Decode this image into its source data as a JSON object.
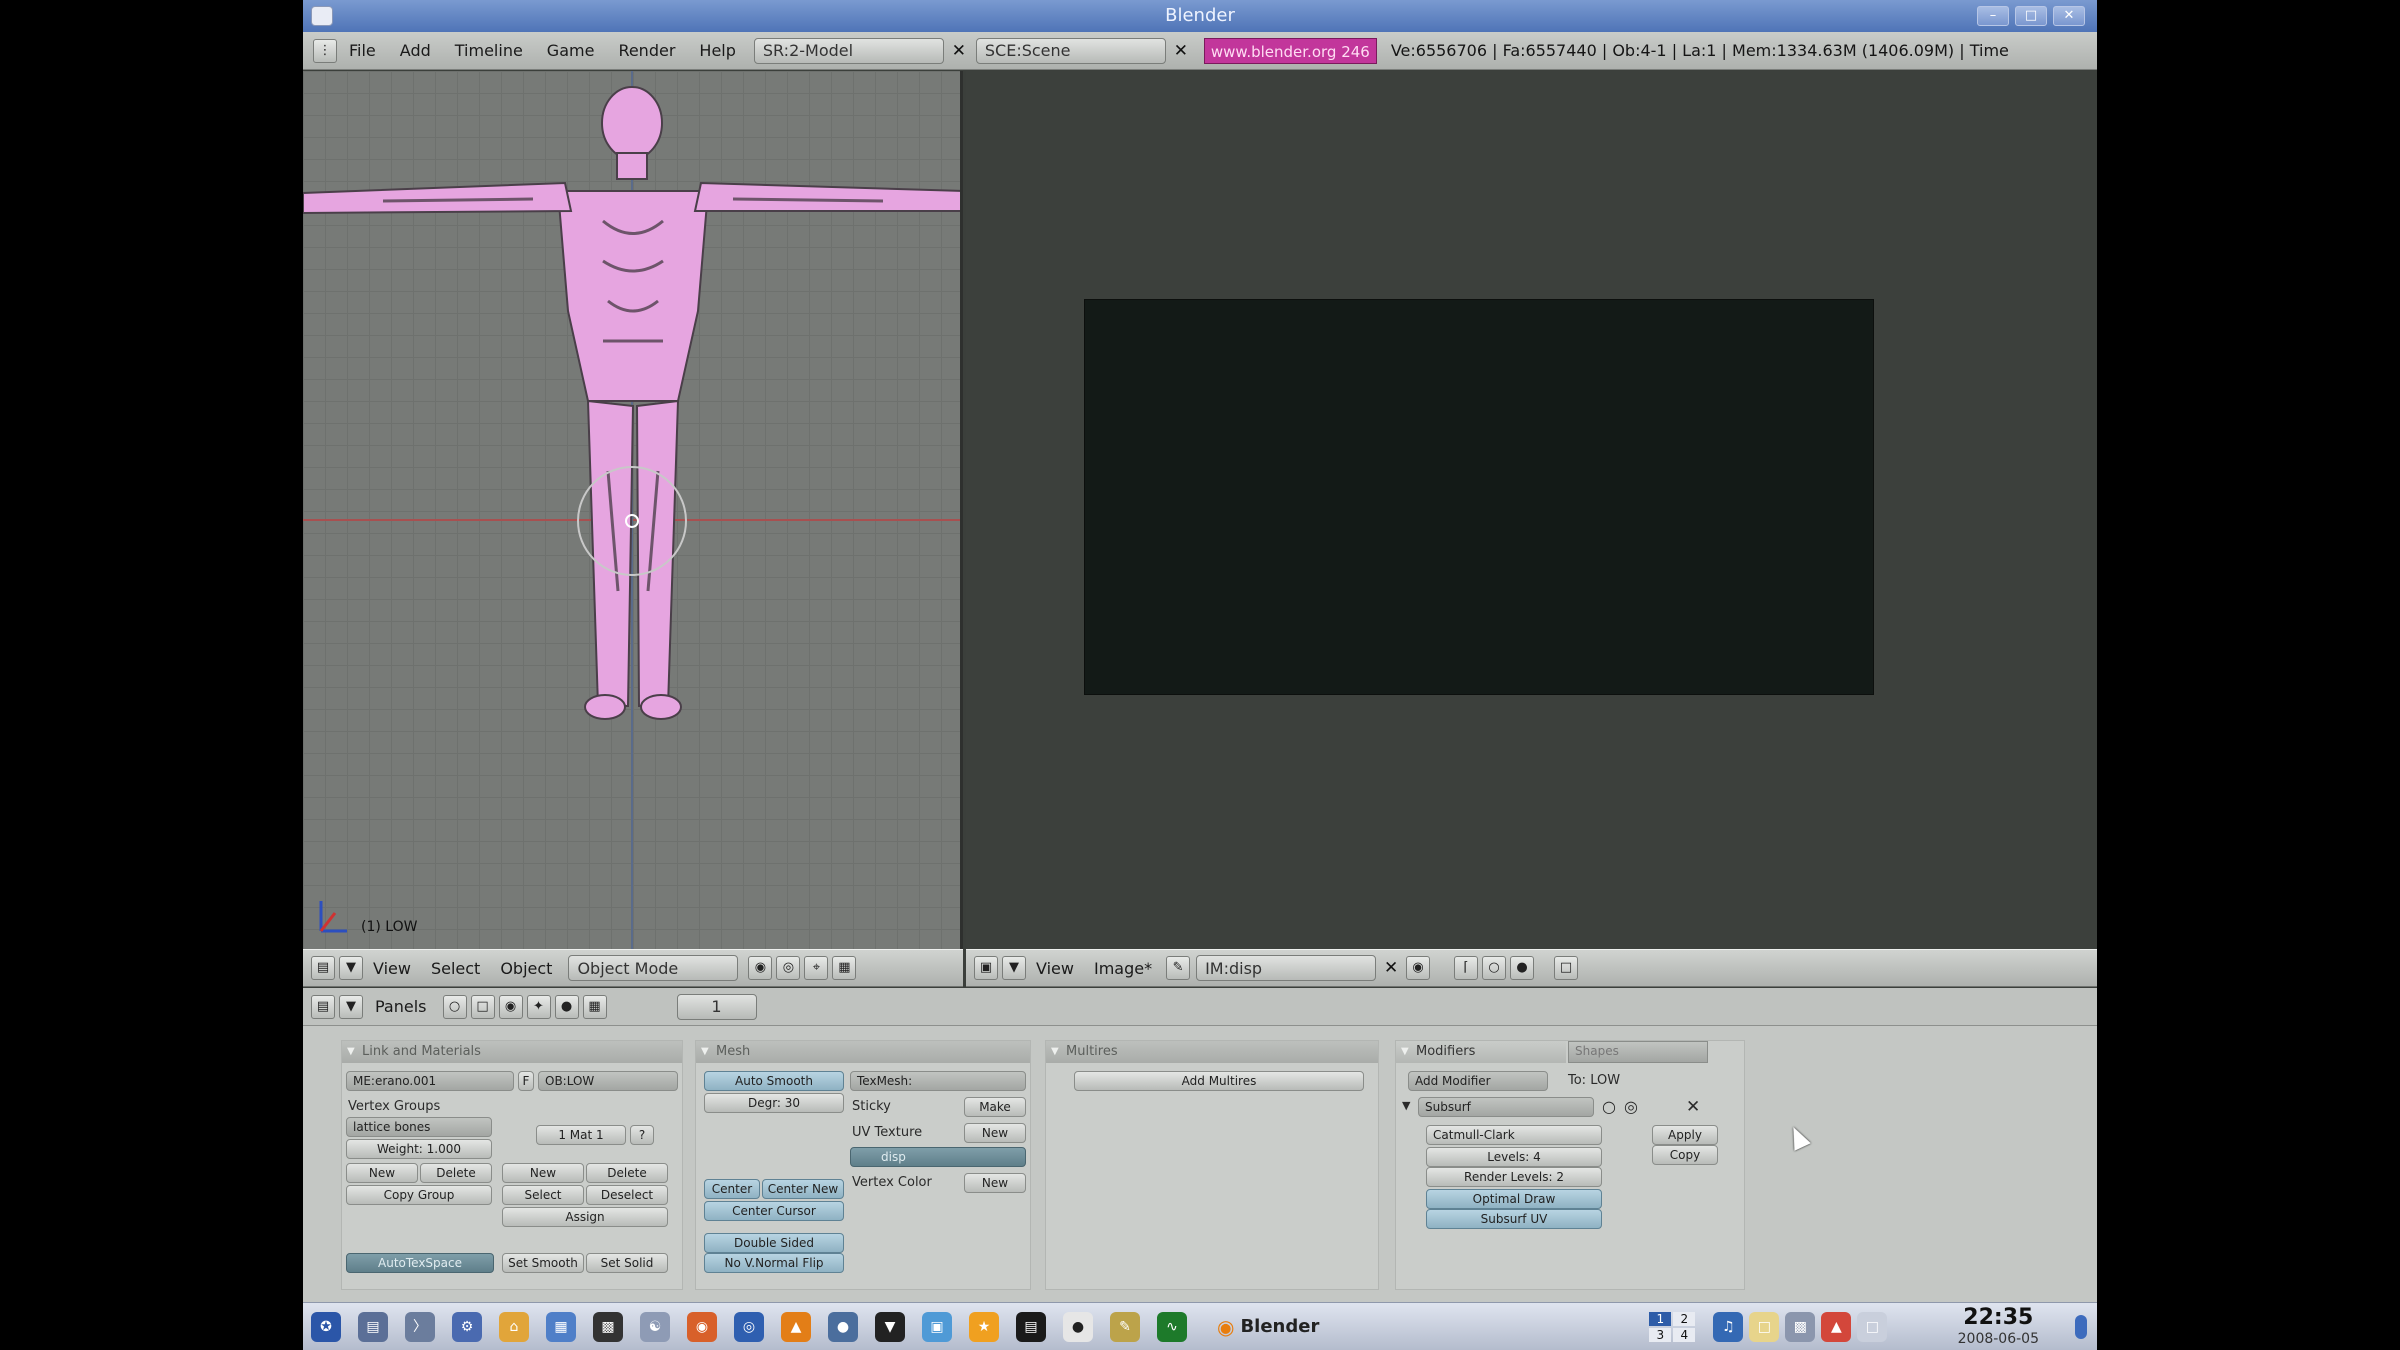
{
  "window": {
    "title": "Blender",
    "controls": [
      "minimize-icon",
      "maximize-icon",
      "close-icon"
    ]
  },
  "topmenu": {
    "items": [
      "File",
      "Add",
      "Timeline",
      "Game",
      "Render",
      "Help"
    ],
    "screen": "SR:2-Model",
    "scene": "SCE:Scene",
    "site": "www.blender.org 246",
    "stats": "Ve:6556706 | Fa:6557440 | Ob:4-1 | La:1   | Mem:1334.63M (1406.09M)   | Time"
  },
  "viewport3d": {
    "label": "(1) LOW",
    "figure_color": "#e6a5e0"
  },
  "view3d_header": {
    "menus": [
      "View",
      "Select",
      "Object"
    ],
    "mode": "Object Mode"
  },
  "image_header": {
    "menus": [
      "View",
      "Image*"
    ],
    "image": "IM:disp"
  },
  "panels_bar": {
    "label": "Panels",
    "frame": "1"
  },
  "panel_link": {
    "title": "Link and Materials",
    "mesh": "ME:erano.001",
    "f": "F",
    "object": "OB:LOW",
    "vertex_groups": "Vertex Groups",
    "group": "lattice bones",
    "weight": "Weight: 1.000",
    "mat": "1 Mat 1",
    "q": "?",
    "new1": "New",
    "delete1": "Delete",
    "new2": "New",
    "delete2": "Delete",
    "copy_group": "Copy Group",
    "select": "Select",
    "deselect": "Deselect",
    "assign": "Assign",
    "autotex": "AutoTexSpace",
    "set_smooth": "Set Smooth",
    "set_solid": "Set Solid"
  },
  "panel_mesh": {
    "title": "Mesh",
    "auto_smooth": "Auto Smooth",
    "degr": "Degr: 30",
    "texmesh": "TexMesh:",
    "sticky": "Sticky",
    "make": "Make",
    "uv_texture": "UV Texture",
    "uv_new": "New",
    "uv_name": "disp",
    "vertex_color": "Vertex Color",
    "vc_new": "New",
    "center": "Center",
    "center_new": "Center New",
    "center_cursor": "Center Cursor",
    "double_sided": "Double Sided",
    "no_v_normal_flip": "No V.Normal Flip"
  },
  "panel_multires": {
    "title": "Multires",
    "add": "Add Multires"
  },
  "panel_modifiers": {
    "tab_modifiers": "Modifiers",
    "tab_shapes": "Shapes",
    "add_modifier": "Add Modifier",
    "to": "To: LOW",
    "modifier_name": "Subsurf",
    "type": "Catmull-Clark",
    "levels": "Levels: 4",
    "render_levels": "Render Levels: 2",
    "optimal_draw": "Optimal Draw",
    "subsurf_uv": "Subsurf UV",
    "apply": "Apply",
    "copy": "Copy"
  },
  "taskbar": {
    "active_app": "Blender",
    "workspaces": [
      "1",
      "2",
      "3",
      "4"
    ],
    "time": "22:35",
    "date": "2008-06-05"
  },
  "colors": {
    "accent_pink": "#c2369b",
    "model_pink": "#e6a5e0",
    "viewport_bg": "#777a77",
    "image_bg": "#131a17"
  }
}
